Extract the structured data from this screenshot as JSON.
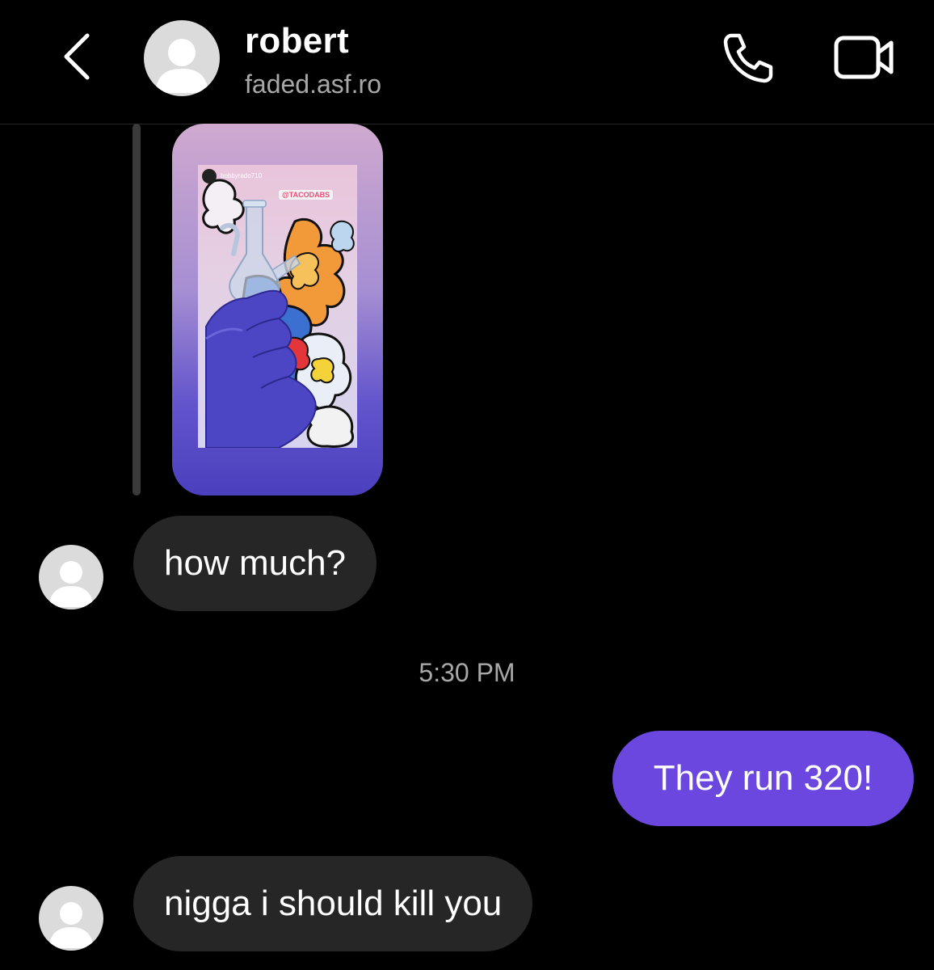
{
  "header": {
    "back_icon": "chevron-left-icon",
    "title": "robert",
    "subtitle": "faded.asf.ro",
    "call_icon": "phone-icon",
    "video_icon": "video-camera-icon"
  },
  "story": {
    "username": "bobbyrado710",
    "tag": "@TACODABS"
  },
  "messages": [
    {
      "direction": "incoming",
      "text": "how much?"
    },
    {
      "direction": "outgoing",
      "text": "They run 320!"
    },
    {
      "direction": "incoming",
      "text": "nigga i should kill you"
    }
  ],
  "timestamp": "5:30 PM",
  "colors": {
    "background": "#000000",
    "incoming_bubble": "#262626",
    "outgoing_bubble": "#6b47e0",
    "secondary_text": "#a8a8a8"
  }
}
